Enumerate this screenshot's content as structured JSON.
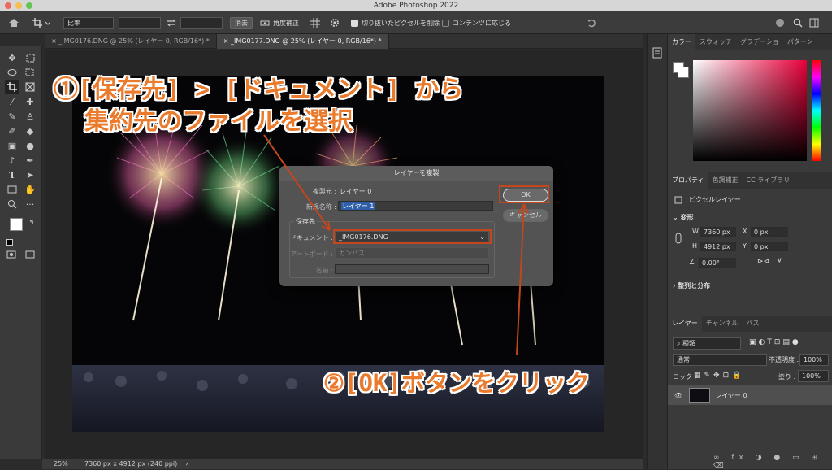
{
  "app": {
    "title": "Adobe Photoshop 2022"
  },
  "options_bar": {
    "ratio_select": "比率",
    "clear_label": "消去",
    "straighten_label": "角度補正",
    "delete_cropped_label": "切り抜いたピクセルを削除",
    "content_aware_label": "コンテンツに応じる"
  },
  "tabs": [
    {
      "label": "_IMG0176.DNG @ 25% (レイヤー 0, RGB/16*) *"
    },
    {
      "label": "_IMG0177.DNG @ 25% (レイヤー 0, RGB/16*) *"
    }
  ],
  "status": {
    "zoom": "25%",
    "info": "7360 px x 4912 px (240 ppi)"
  },
  "dialog": {
    "title": "レイヤーを複製",
    "source_label": "複製元 :",
    "source_value": "レイヤー 0",
    "newname_label": "新規名称 :",
    "newname_value": "レイヤー 1",
    "destination_section": "保存先",
    "document_label": "ドキュメント :",
    "document_value": "_IMG0176.DNG",
    "artboard_label": "アートボード :",
    "artboard_value": "カンバス",
    "name_label": "名前 :",
    "name_value": "",
    "ok_label": "OK",
    "cancel_label": "キャンセル"
  },
  "annotations": {
    "step1_line1": "①[保存先] > [ドキュメント] から",
    "step1_line2": "集約先のファイルを選択",
    "step2": "②[OK]ボタンをクリック"
  },
  "color_panel": {
    "tabs": [
      "カラー",
      "スウォッチ",
      "グラデーショ",
      "パターン"
    ]
  },
  "properties_panel": {
    "tabs": [
      "プロパティ",
      "色調補正",
      "CC ライブラリ"
    ],
    "layer_type": "ピクセルレイヤー",
    "transform_label": "変形",
    "w_label": "W",
    "w_value": "7360 px",
    "h_label": "H",
    "h_value": "4912 px",
    "x_label": "X",
    "x_value": "0 px",
    "y_label": "Y",
    "y_value": "0 px",
    "angle_value": "0.00°",
    "align_label": "整列と分布"
  },
  "layers_panel": {
    "tabs": [
      "レイヤー",
      "チャンネル",
      "パス"
    ],
    "filter_select": "種類",
    "blend_mode": "通常",
    "opacity_label": "不透明度 :",
    "opacity_value": "100%",
    "lock_label": "ロック :",
    "fill_label": "塗り :",
    "fill_value": "100%",
    "layer_name": "レイヤー 0"
  },
  "colors": {
    "accent_orange": "#ea7a2c",
    "highlight_red": "#c4461c",
    "selection_blue": "#2f5fa8"
  }
}
